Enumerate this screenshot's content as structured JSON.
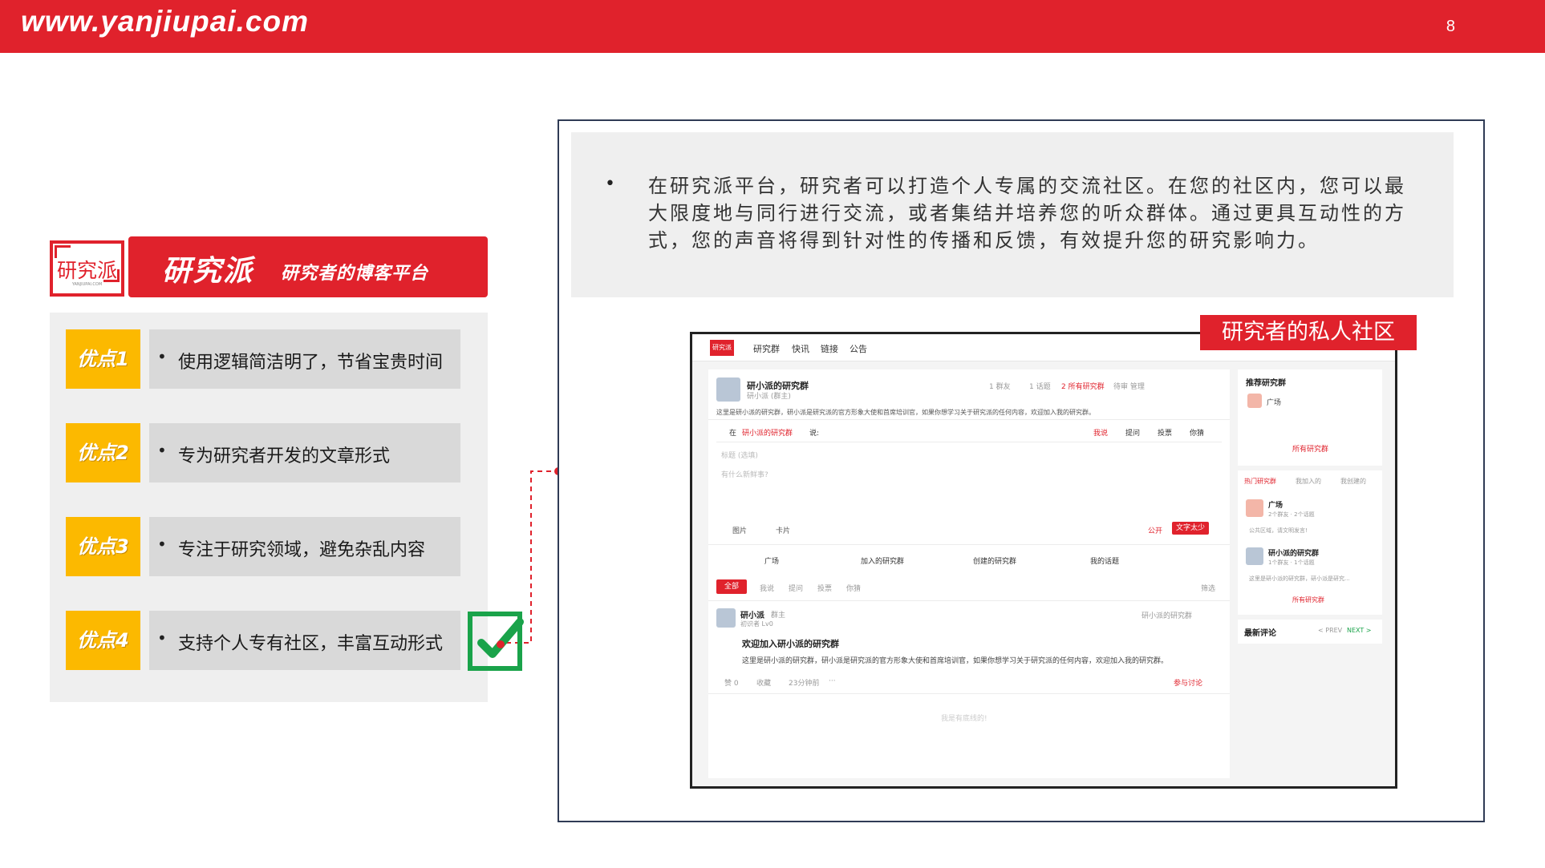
{
  "header": {
    "url": "www.yanjiupai.com",
    "page_number": "8"
  },
  "brand": {
    "logo_text": "研究派",
    "logo_sub": "YANJIUPAI.COM",
    "name": "研究派",
    "tagline": "研究者的博客平台"
  },
  "advantages": [
    {
      "badge": "优点1",
      "text": "使用逻辑简洁明了，节省宝贵时间"
    },
    {
      "badge": "优点2",
      "text": "专为研究者开发的文章形式"
    },
    {
      "badge": "优点3",
      "text": "专注于研究领域，避免杂乱内容"
    },
    {
      "badge": "优点4",
      "text": "支持个人专有社区，丰富互动形式"
    }
  ],
  "description": {
    "bullet": "•",
    "text": "在研究派平台，研究者可以打造个人专属的交流社区。在您的社区内，您可以最大限度地与同行进行交流，或者集结并培养您的听众群体。通过更具互动性的方式，您的声音将得到针对性的传播和反馈，有效提升您的研究影响力。"
  },
  "community_label": "研究者的私人社区",
  "mini_screen": {
    "logo": "研究派",
    "nav": [
      "研究群",
      "快讯",
      "链接",
      "公告"
    ],
    "group_name": "研小派的研究群",
    "group_owner": "研小派 (群主)",
    "group_desc": "这里是研小派的研究群，研小派是研究派的官方形象大使和首席培训官，如果你想学习关于研究派的任何内容，欢迎加入我的研究群。",
    "stats": [
      "1 群友",
      "1 话题",
      "2 所有研究群",
      "待审 管理"
    ],
    "post_in": "在",
    "post_group": "研小派的研究群",
    "post_say": "说:",
    "post_types": [
      "我说",
      "提问",
      "投票",
      "你猜"
    ],
    "title_placeholder": "标题 (选填)",
    "body_placeholder": "有什么新鲜事?",
    "attach": [
      "图片",
      "卡片"
    ],
    "public": "公开",
    "submit": "文字太少",
    "tabs": [
      "广场",
      "加入的研究群",
      "创建的研究群",
      "我的话题"
    ],
    "filters": [
      "全部",
      "我说",
      "提问",
      "投票",
      "你猜"
    ],
    "filter_right": "筛选",
    "post_author": "研小派",
    "post_role": "群主",
    "post_level": "初识者 Lv0",
    "post_group_tag": "研小派的研究群",
    "post_title": "欢迎加入研小派的研究群",
    "post_body": "这里是研小派的研究群，研小派是研究派的官方形象大使和首席培训官，如果你想学习关于研究派的任何内容，欢迎加入我的研究群。",
    "post_actions": [
      "赞 0",
      "收藏",
      "23分钟前",
      "···"
    ],
    "join": "参与讨论",
    "footer": "我是有底线的!",
    "side_title": "推荐研究群",
    "side_item": "广场",
    "all_groups": "所有研究群",
    "side_tabs": [
      "热门研究群",
      "我加入的",
      "我创建的"
    ],
    "side_group1": "广场",
    "side_group1_meta": "2个群友 · 2个话题",
    "side_group1_desc": "公共区域，请文明发言!",
    "side_group2": "研小派的研究群",
    "side_group2_meta": "1个群友 · 1个话题",
    "side_group2_desc": "这里是研小派的研究群，研小派是研究...",
    "latest_comments": "最新评论",
    "prev": "< PREV",
    "next": "NEXT >"
  }
}
